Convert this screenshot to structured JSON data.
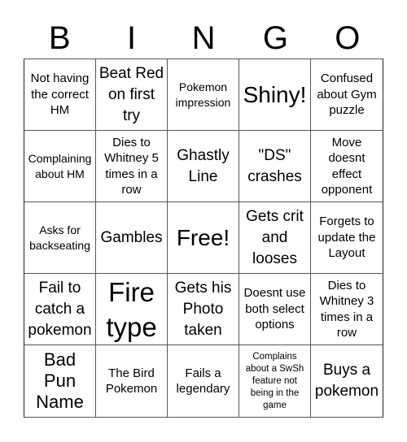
{
  "header": [
    "B",
    "I",
    "N",
    "G",
    "O"
  ],
  "cells": [
    {
      "text": "Not having the correct HM",
      "size": "s-md"
    },
    {
      "text": "Beat Red on first try",
      "size": "s-lg"
    },
    {
      "text": "Pokemon impression",
      "size": "s-sm"
    },
    {
      "text": "Shiny!",
      "size": "s-xxl"
    },
    {
      "text": "Confused about Gym puzzle",
      "size": "s-md"
    },
    {
      "text": "Complaining about HM",
      "size": "s-sm"
    },
    {
      "text": "Dies to Whitney 5 times in a row",
      "size": "s-md"
    },
    {
      "text": "Ghastly Line",
      "size": "s-lg"
    },
    {
      "text": "\"DS\" crashes",
      "size": "s-lg"
    },
    {
      "text": "Move doesnt effect opponent",
      "size": "s-md"
    },
    {
      "text": "Asks for backseating",
      "size": "s-sm"
    },
    {
      "text": "Gambles",
      "size": "s-lg"
    },
    {
      "text": "Free!",
      "size": "s-xxl"
    },
    {
      "text": "Gets crit and looses",
      "size": "s-lg"
    },
    {
      "text": "Forgets to update the Layout",
      "size": "s-md"
    },
    {
      "text": "Fail to catch a pokemon",
      "size": "s-lg"
    },
    {
      "text": "Fire type",
      "size": "s-huge"
    },
    {
      "text": "Gets his Photo taken",
      "size": "s-lg"
    },
    {
      "text": "Doesnt use both select options",
      "size": "s-md"
    },
    {
      "text": "Dies to Whitney 3 times in a row",
      "size": "s-md"
    },
    {
      "text": "Bad Pun Name",
      "size": "s-xl"
    },
    {
      "text": "The Bird Pokemon",
      "size": "s-md"
    },
    {
      "text": "Fails a legendary",
      "size": "s-md"
    },
    {
      "text": "Complains about a SwSh feature not being in the game",
      "size": "s-xs"
    },
    {
      "text": "Buys a pokemon",
      "size": "s-lg"
    }
  ]
}
